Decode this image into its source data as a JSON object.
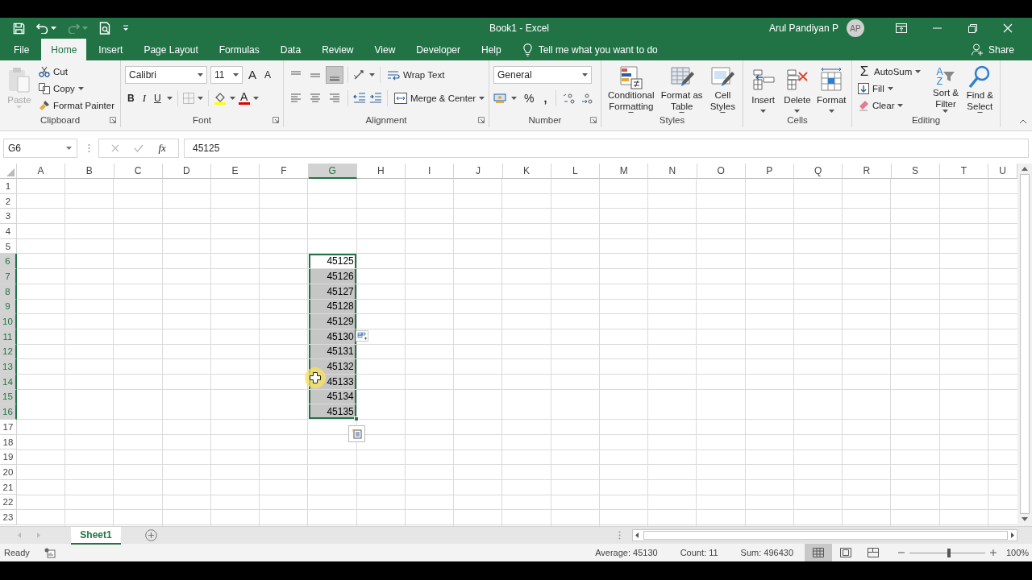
{
  "title_bar": {
    "title": "Book1 - Excel",
    "user": "Arul Pandiyan P",
    "avatar": "AP"
  },
  "tabs": [
    {
      "label": "File",
      "selected": false
    },
    {
      "label": "Home",
      "selected": true
    },
    {
      "label": "Insert",
      "selected": false
    },
    {
      "label": "Page Layout",
      "selected": false
    },
    {
      "label": "Formulas",
      "selected": false
    },
    {
      "label": "Data",
      "selected": false
    },
    {
      "label": "Review",
      "selected": false
    },
    {
      "label": "View",
      "selected": false
    },
    {
      "label": "Developer",
      "selected": false
    },
    {
      "label": "Help",
      "selected": false
    }
  ],
  "tell_me": {
    "placeholder": "Tell me what you want to do"
  },
  "share": "Share",
  "ribbon": {
    "groups": [
      {
        "kind": "clipboard",
        "label": "Clipboard",
        "paste": {
          "label": "Paste",
          "disabled": true
        },
        "items": [
          "Cut",
          "Copy",
          "Format Painter"
        ]
      },
      {
        "kind": "font",
        "label": "Font",
        "font": "Calibri",
        "size": "11",
        "grow": "A",
        "shrink": "A",
        "bold": "B",
        "italic": "I",
        "underline": "U",
        "font_color": "A"
      },
      {
        "kind": "alignment",
        "label": "Alignment",
        "vertical_align": [
          {
            "selected": false
          },
          {
            "selected": false
          },
          {
            "selected": true
          }
        ],
        "wrap": "Wrap Text",
        "merge": "Merge & Center"
      },
      {
        "kind": "number",
        "label": "Number",
        "format": "General",
        "percent": "%",
        "comma": ","
      },
      {
        "kind": "styles",
        "label": "Styles",
        "buttons": [
          "Conditional Formatting",
          "Format as Table",
          "Cell Styles"
        ]
      },
      {
        "kind": "cells",
        "label": "Cells",
        "buttons": [
          "Insert",
          "Delete",
          "Format"
        ]
      },
      {
        "kind": "editing",
        "label": "Editing",
        "sigma": "Σ",
        "autosum": "AutoSum",
        "fill": "Fill",
        "clear": "Clear",
        "sort_letters": [
          "A",
          "Z"
        ],
        "sort": "Sort & Filter",
        "find": "Find & Select"
      }
    ]
  },
  "formula_bar": {
    "name_box": "G6",
    "fx": "fx",
    "value": "45125"
  },
  "grid": {
    "columns": [
      {
        "label": "A",
        "selected": false
      },
      {
        "label": "B",
        "selected": false
      },
      {
        "label": "C",
        "selected": false
      },
      {
        "label": "D",
        "selected": false
      },
      {
        "label": "E",
        "selected": false
      },
      {
        "label": "F",
        "selected": false
      },
      {
        "label": "G",
        "selected": true
      },
      {
        "label": "H",
        "selected": false
      },
      {
        "label": "I",
        "selected": false
      },
      {
        "label": "J",
        "selected": false
      },
      {
        "label": "K",
        "selected": false
      },
      {
        "label": "L",
        "selected": false
      },
      {
        "label": "M",
        "selected": false
      },
      {
        "label": "N",
        "selected": false
      },
      {
        "label": "O",
        "selected": false
      },
      {
        "label": "P",
        "selected": false
      },
      {
        "label": "Q",
        "selected": false
      },
      {
        "label": "R",
        "selected": false
      },
      {
        "label": "S",
        "selected": false
      },
      {
        "label": "T",
        "selected": false
      },
      {
        "label": "U",
        "selected": false
      }
    ],
    "rows": [
      {
        "label": "1",
        "selected": false
      },
      {
        "label": "2",
        "selected": false
      },
      {
        "label": "3",
        "selected": false
      },
      {
        "label": "4",
        "selected": false
      },
      {
        "label": "5",
        "selected": false
      },
      {
        "label": "6",
        "selected": true,
        "cells": {
          "G": {
            "value": "45125",
            "selected": true,
            "active": true
          }
        }
      },
      {
        "label": "7",
        "selected": true,
        "cells": {
          "G": {
            "value": "45126",
            "selected": true,
            "active": false
          }
        }
      },
      {
        "label": "8",
        "selected": true,
        "cells": {
          "G": {
            "value": "45127",
            "selected": true,
            "active": false
          }
        }
      },
      {
        "label": "9",
        "selected": true,
        "cells": {
          "G": {
            "value": "45128",
            "selected": true,
            "active": false
          }
        }
      },
      {
        "label": "10",
        "selected": true,
        "cells": {
          "G": {
            "value": "45129",
            "selected": true,
            "active": false
          }
        }
      },
      {
        "label": "11",
        "selected": true,
        "cells": {
          "G": {
            "value": "45130",
            "selected": true,
            "active": false
          }
        }
      },
      {
        "label": "12",
        "selected": true,
        "cells": {
          "G": {
            "value": "45131",
            "selected": true,
            "active": false
          }
        }
      },
      {
        "label": "13",
        "selected": true,
        "cells": {
          "G": {
            "value": "45132",
            "selected": true,
            "active": false
          }
        }
      },
      {
        "label": "14",
        "selected": true,
        "cells": {
          "G": {
            "value": "45133",
            "selected": true,
            "active": false
          }
        }
      },
      {
        "label": "15",
        "selected": true,
        "cells": {
          "G": {
            "value": "45134",
            "selected": true,
            "active": false
          }
        }
      },
      {
        "label": "16",
        "selected": true,
        "cells": {
          "G": {
            "value": "45135",
            "selected": true,
            "active": false
          }
        }
      },
      {
        "label": "17",
        "selected": false
      },
      {
        "label": "18",
        "selected": false
      },
      {
        "label": "19",
        "selected": false
      },
      {
        "label": "20",
        "selected": false
      },
      {
        "label": "21",
        "selected": false
      },
      {
        "label": "22",
        "selected": false
      },
      {
        "label": "23",
        "selected": false
      }
    ]
  },
  "sheet_tabs": [
    {
      "label": "Sheet1",
      "selected": true
    }
  ],
  "status_bar": {
    "mode": "Ready",
    "average": "Average: 45130",
    "count": "Count: 11",
    "sum": "Sum: 496430",
    "views": [
      {
        "kind": "normal",
        "selected": true
      },
      {
        "kind": "page_layout",
        "selected": false
      },
      {
        "kind": "page_break",
        "selected": false
      }
    ],
    "zoom": {
      "level": 0.52,
      "reading": "100%"
    }
  }
}
